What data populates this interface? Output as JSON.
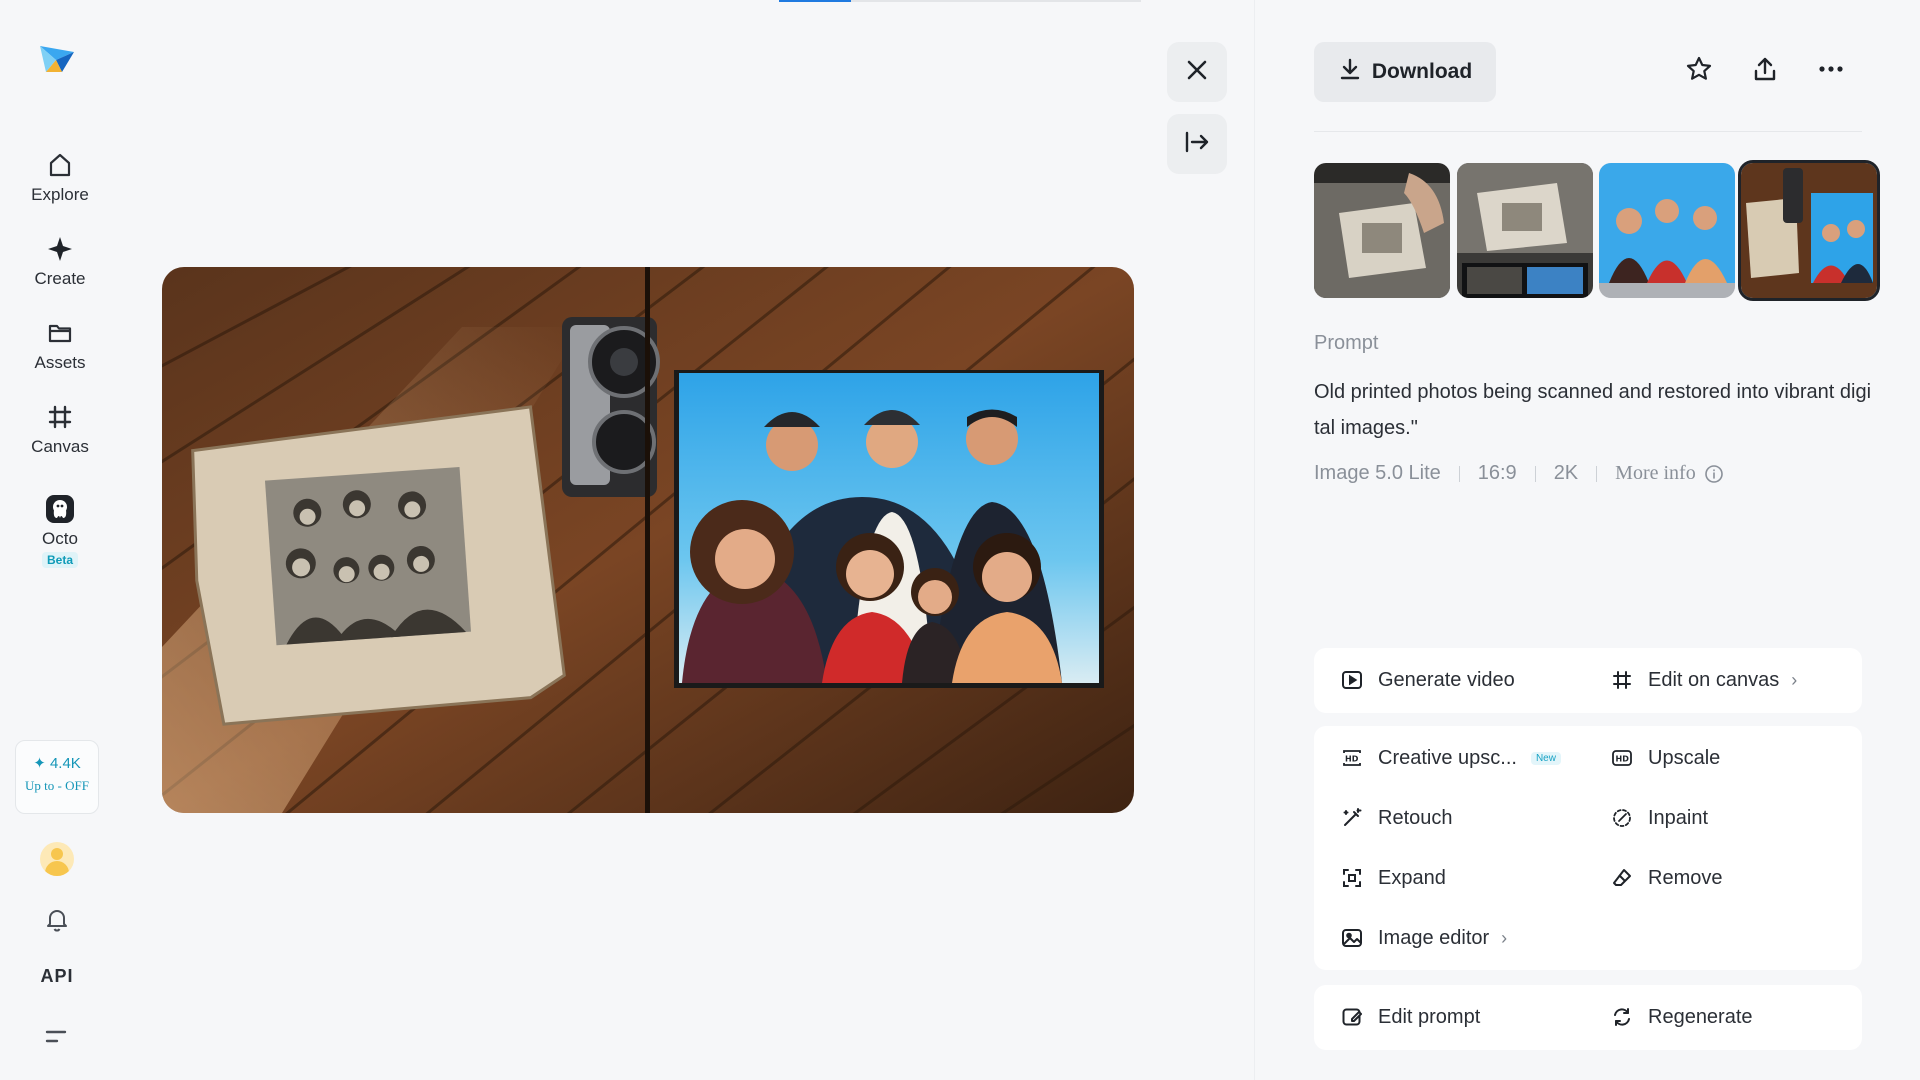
{
  "progress": {
    "fraction": 0.2
  },
  "sidebar": {
    "items": [
      {
        "label": "Explore",
        "icon": "home-icon"
      },
      {
        "label": "Create",
        "icon": "sparkle-icon"
      },
      {
        "label": "Assets",
        "icon": "folder-icon"
      },
      {
        "label": "Canvas",
        "icon": "hash-canvas-icon"
      },
      {
        "label": "Octo",
        "icon": "octo-icon",
        "badge": "Beta"
      }
    ],
    "credits": {
      "value": "4.4K",
      "promo": "Up to - OFF"
    },
    "api_label": "API"
  },
  "panel": {
    "download_label": "Download",
    "prompt_title": "Prompt",
    "prompt_text": "Old printed photos being scanned and restored into vibrant digital images.\"",
    "meta": {
      "model": "Image 5.0 Lite",
      "ratio": "16:9",
      "resolution": "2K",
      "more_info": "More info"
    },
    "actions": {
      "generate_video": "Generate video",
      "edit_on_canvas": "Edit on canvas",
      "creative_upscale": "Creative upsc...",
      "new_badge": "New",
      "upscale": "Upscale",
      "retouch": "Retouch",
      "inpaint": "Inpaint",
      "expand": "Expand",
      "remove": "Remove",
      "image_editor": "Image editor",
      "edit_prompt": "Edit prompt",
      "regenerate": "Regenerate"
    }
  },
  "colors": {
    "accent": "#1f7ae0",
    "brand_teal": "#1596b8",
    "background": "#f6f7f9"
  }
}
